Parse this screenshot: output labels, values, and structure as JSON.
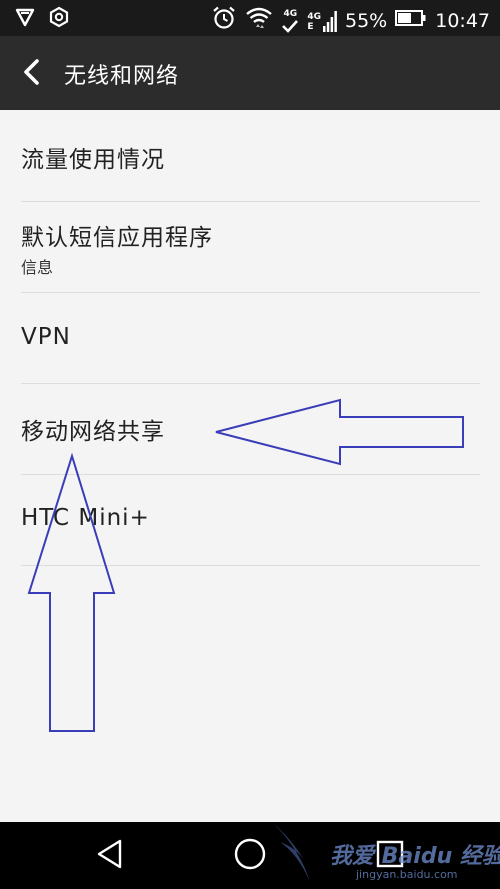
{
  "status_bar": {
    "battery": "55%",
    "time": "10:47",
    "network_badge_1": "4G",
    "network_badge_2": "4G",
    "network_badge_2_sub": "E",
    "icons": [
      "vpn-shield-icon",
      "settings-badge-icon",
      "alarm-clock-icon",
      "wifi-icon",
      "signal-icon",
      "battery-icon"
    ]
  },
  "app_bar": {
    "title": "无线和网络",
    "back_icon": "chevron-left-icon"
  },
  "list": {
    "items": [
      {
        "title": "流量使用情况",
        "subtitle": ""
      },
      {
        "title": "默认短信应用程序",
        "subtitle": "信息"
      },
      {
        "title": "VPN",
        "subtitle": ""
      },
      {
        "title": "移动网络共享",
        "subtitle": ""
      },
      {
        "title": "HTC Mini+",
        "subtitle": ""
      }
    ]
  },
  "annotations": {
    "arrow_color": "#3a3db8",
    "description_icons": [
      "left-arrow-annotation",
      "up-arrow-annotation"
    ]
  },
  "nav_bar": {
    "icons": [
      "back-triangle-icon",
      "home-circle-icon",
      "recents-square-icon"
    ]
  },
  "watermark": {
    "main": "我爱 Baidu 经验",
    "sub": "jingyan.baidu.com"
  }
}
